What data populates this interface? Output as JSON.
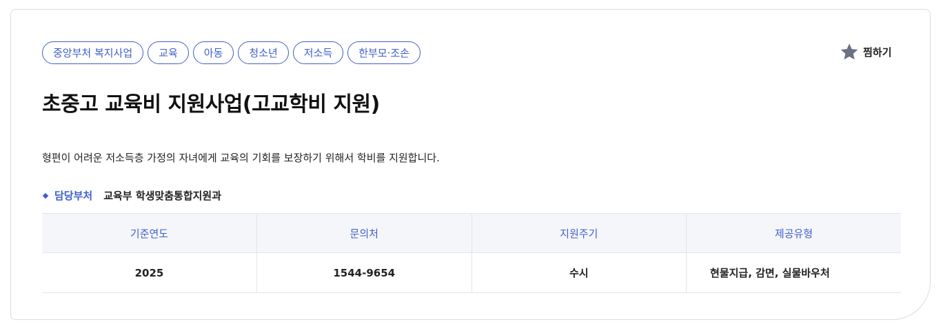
{
  "tags": [
    "중앙부처 복지사업",
    "교육",
    "아동",
    "청소년",
    "저소득",
    "한부모·조손"
  ],
  "favorite": {
    "label": "찜하기",
    "icon": "star-icon",
    "icon_color": "#6b7184"
  },
  "title": "초중고 교육비 지원사업(고교학비 지원)",
  "description": "형편이 어려운 저소득층 가정의 자녀에게 교육의 기회를 보장하기 위해서 학비를 지원합니다.",
  "department": {
    "label": "담당부처",
    "value": "교육부 학생맞춤통합지원과"
  },
  "table": {
    "headers": [
      "기준연도",
      "문의처",
      "지원주기",
      "제공유형"
    ],
    "row": [
      "2025",
      "1544-9654",
      "수시",
      "현물지급, 감면, 실물바우처"
    ]
  },
  "colors": {
    "accent": "#3f5fc9",
    "header_bg": "#f5f6fa",
    "border": "#dcdcdc"
  }
}
